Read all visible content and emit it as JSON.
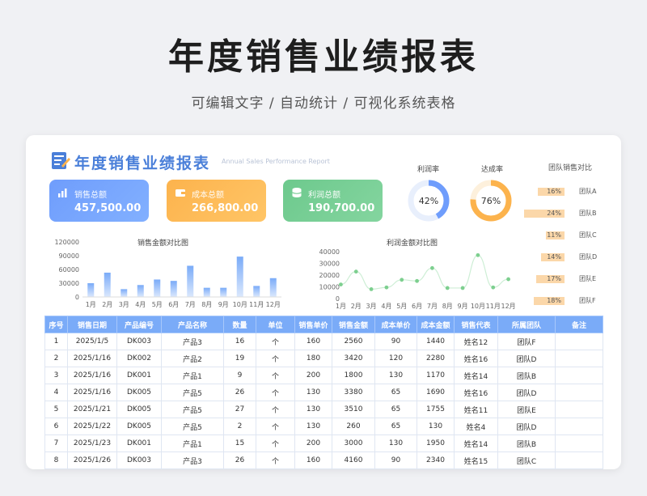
{
  "page": {
    "title": "年度销售业绩报表",
    "subtitle": "可编辑文字 / 自动统计 / 可视化系统表格"
  },
  "report": {
    "title": "年度销售业绩报表",
    "subtitle_en": "Annual Sales Performance Report"
  },
  "kpis": [
    {
      "label": "销售总额",
      "value": "457,500.00",
      "icon": "bar-chart-icon",
      "color": "#6f9dfc"
    },
    {
      "label": "成本总额",
      "value": "266,800.00",
      "icon": "wallet-icon",
      "color": "#fcb34d"
    },
    {
      "label": "利润总额",
      "value": "190,700.00",
      "icon": "database-icon",
      "color": "#6dc98d"
    }
  ],
  "gauges": [
    {
      "label": "利润率",
      "value": 42,
      "text": "42%",
      "color": "#6f9dfc"
    },
    {
      "label": "达成率",
      "value": 76,
      "text": "76%",
      "color": "#fcb34d"
    }
  ],
  "team_compare": {
    "title": "团队销售对比",
    "items": [
      {
        "name": "团队A",
        "value": 16,
        "text": "16%"
      },
      {
        "name": "团队B",
        "value": 24,
        "text": "24%"
      },
      {
        "name": "团队C",
        "value": 11,
        "text": "11%"
      },
      {
        "name": "团队D",
        "value": 14,
        "text": "14%"
      },
      {
        "name": "团队E",
        "value": 17,
        "text": "17%"
      },
      {
        "name": "团队F",
        "value": 18,
        "text": "18%"
      }
    ]
  },
  "chart_data": [
    {
      "type": "bar",
      "title": "销售金额对比图",
      "categories": [
        "1月",
        "2月",
        "3月",
        "4月",
        "5月",
        "6月",
        "7月",
        "8月",
        "9月",
        "10月",
        "11月",
        "12月"
      ],
      "values": [
        30000,
        53000,
        17000,
        26000,
        38000,
        35000,
        68000,
        20000,
        20000,
        88000,
        24000,
        41000
      ],
      "yticks": [
        "120000",
        "90000",
        "60000",
        "30000",
        "0"
      ],
      "ylim": [
        0,
        120000
      ],
      "color": "#7aabf8"
    },
    {
      "type": "line",
      "title": "利润金额对比图",
      "categories": [
        "1月",
        "2月",
        "3月",
        "4月",
        "5月",
        "6月",
        "7月",
        "8月",
        "9月",
        "10月",
        "11月",
        "12月"
      ],
      "values": [
        12000,
        23000,
        8000,
        9500,
        16000,
        15000,
        26000,
        9000,
        9000,
        37000,
        9500,
        16500
      ],
      "yticks": [
        "40000",
        "30000",
        "20000",
        "10000",
        "0"
      ],
      "ylim": [
        0,
        40000
      ],
      "color": "#7dcf8f"
    }
  ],
  "table": {
    "headers": [
      "序号",
      "销售日期",
      "产品编号",
      "产品名称",
      "数量",
      "单位",
      "销售单价",
      "销售金额",
      "成本单价",
      "成本金额",
      "销售代表",
      "所属团队",
      "备注"
    ],
    "rows": [
      [
        "1",
        "2025/1/5",
        "DK003",
        "产品3",
        "16",
        "个",
        "160",
        "2560",
        "90",
        "1440",
        "姓名12",
        "团队F",
        ""
      ],
      [
        "2",
        "2025/1/16",
        "DK002",
        "产品2",
        "19",
        "个",
        "180",
        "3420",
        "120",
        "2280",
        "姓名16",
        "团队D",
        ""
      ],
      [
        "3",
        "2025/1/16",
        "DK001",
        "产品1",
        "9",
        "个",
        "200",
        "1800",
        "130",
        "1170",
        "姓名14",
        "团队B",
        ""
      ],
      [
        "4",
        "2025/1/16",
        "DK005",
        "产品5",
        "26",
        "个",
        "130",
        "3380",
        "65",
        "1690",
        "姓名16",
        "团队D",
        ""
      ],
      [
        "5",
        "2025/1/21",
        "DK005",
        "产品5",
        "27",
        "个",
        "130",
        "3510",
        "65",
        "1755",
        "姓名11",
        "团队E",
        ""
      ],
      [
        "6",
        "2025/1/22",
        "DK005",
        "产品5",
        "2",
        "个",
        "130",
        "260",
        "65",
        "130",
        "姓名4",
        "团队D",
        ""
      ],
      [
        "7",
        "2025/1/23",
        "DK001",
        "产品1",
        "15",
        "个",
        "200",
        "3000",
        "130",
        "1950",
        "姓名14",
        "团队B",
        ""
      ],
      [
        "8",
        "2025/1/26",
        "DK003",
        "产品3",
        "26",
        "个",
        "160",
        "4160",
        "90",
        "2340",
        "姓名15",
        "团队C",
        ""
      ]
    ]
  }
}
